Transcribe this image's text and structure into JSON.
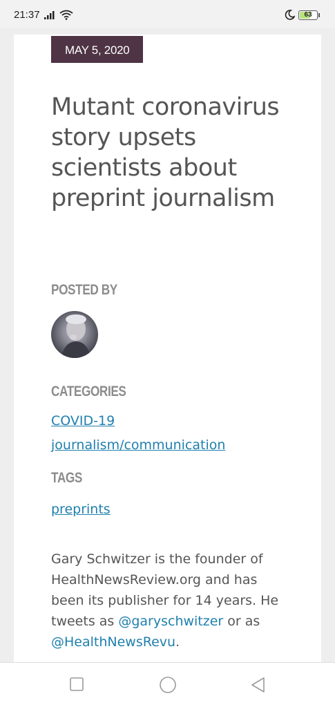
{
  "status_bar": {
    "time": "21:37",
    "battery_level": "63",
    "battery_fraction": 0.63
  },
  "article": {
    "date": "MAY 5, 2020",
    "title": "Mutant coronavirus story upsets scientists about preprint journalism",
    "posted_by_heading": "POSTED BY",
    "categories_heading": "CATEGORIES",
    "categories": [
      "COVID-19",
      "journalism/communication"
    ],
    "tags_heading": "TAGS",
    "tags": [
      "preprints"
    ],
    "bio": {
      "text_1": "Gary Schwitzer is the founder of HealthNewsReview.org and has been its publisher for 14 years. He tweets as ",
      "twitter_1": "@garyschwitzer",
      "text_2": " or as ",
      "twitter_2": "@HealthNewsRevu",
      "text_3": "."
    }
  },
  "colors": {
    "date_badge_bg": "#4e3444",
    "link": "#1f7fae",
    "heading_gray": "#8c8c8c",
    "body_text": "#555555"
  },
  "icons": {
    "signal": "signal-icon",
    "wifi": "wifi-icon",
    "night_mode": "moon-icon",
    "nav_recents": "square-icon",
    "nav_home": "circle-icon",
    "nav_back": "triangle-back-icon"
  }
}
